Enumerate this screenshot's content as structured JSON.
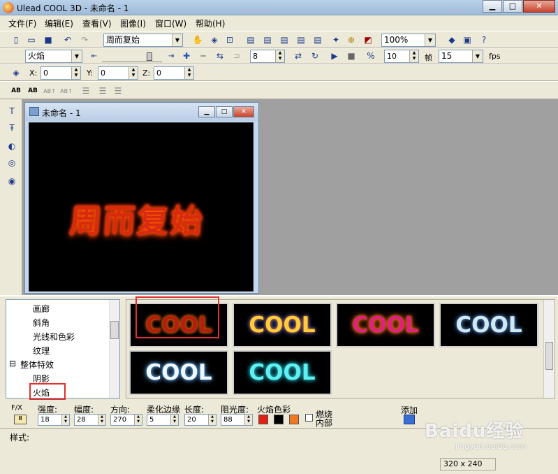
{
  "window": {
    "title": "Ulead COOL 3D - 未命名 - 1"
  },
  "menu": [
    "文件(F)",
    "编辑(E)",
    "查看(V)",
    "图像(I)",
    "窗口(W)",
    "帮助(H)"
  ],
  "toolbar1": {
    "style_combo": "周而复始",
    "zoom_combo": "100%"
  },
  "toolbar2": {
    "effect_combo": "火焰",
    "frame_value": "8",
    "frames": "10",
    "frames_label": "帧",
    "fps_value": "15",
    "fps_label": "fps"
  },
  "toolbar3": {
    "x_label": "X:",
    "x_value": "0",
    "y_label": "Y:",
    "y_value": "0",
    "z_label": "Z:",
    "z_value": "0"
  },
  "toolbar4": {
    "btn1": "AB",
    "btn2": "AB",
    "btn3": "AB↑",
    "btn4": "AB↑"
  },
  "child_window": {
    "title": "未命名 - 1",
    "canvas_text": "周而复始"
  },
  "tree": {
    "items": [
      "画廊",
      "斜角",
      "光线和色彩",
      "纹理",
      "整体特效",
      "阴影",
      "火焰"
    ]
  },
  "gallery": {
    "items": [
      "COOL",
      "COOL",
      "COOL",
      "COOL",
      "COOL",
      "COOL"
    ]
  },
  "params": {
    "fx_label": "F/X",
    "labels": [
      "强度:",
      "幅度:",
      "方向:",
      "柔化边缘",
      "长度:",
      "阻光度:",
      "火焰色彩"
    ],
    "values": [
      "18",
      "28",
      "270",
      "5",
      "20",
      "88"
    ],
    "burn_label": "燃烧",
    "inner_label": "内部",
    "add_label": "添加",
    "colors": [
      "#e02010",
      "#000000",
      "#f07820"
    ]
  },
  "status": {
    "style_label": "样式:",
    "size": "320 x 240"
  },
  "watermark": {
    "text": "Baidu经验",
    "sub": "jingyan.baidu.com"
  }
}
